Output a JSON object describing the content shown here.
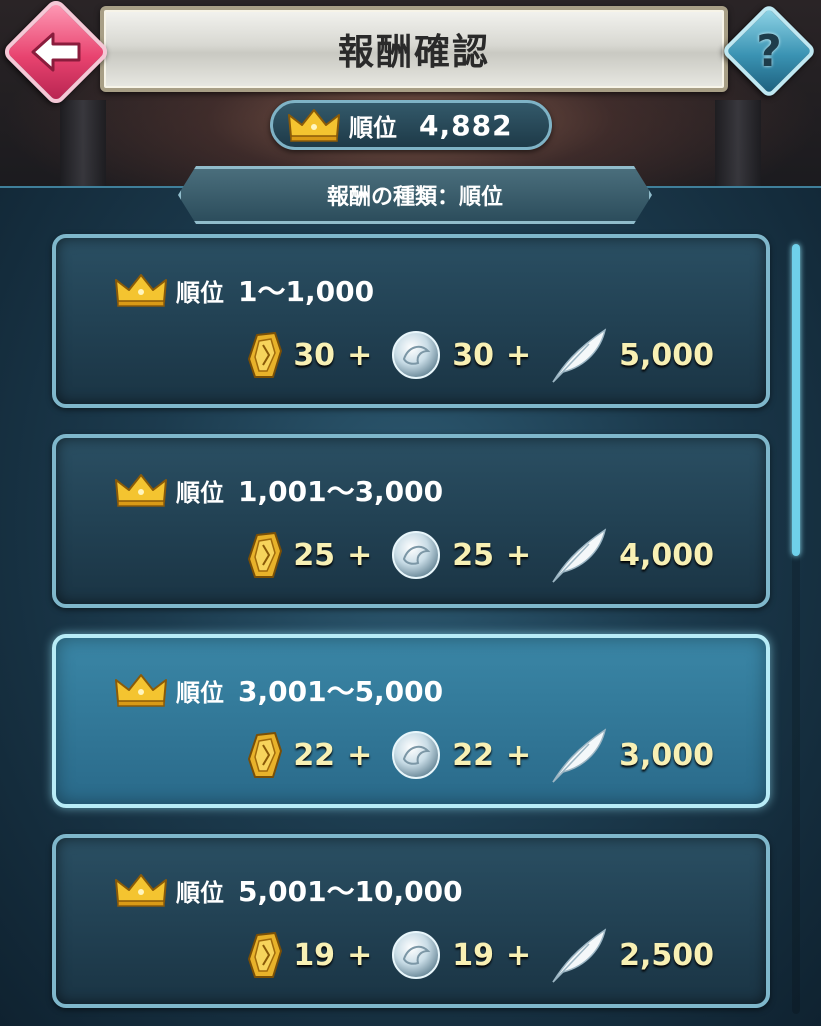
{
  "header": {
    "title": "報酬確認",
    "back_icon": "back-arrow-icon",
    "help_label": "?"
  },
  "current_rank": {
    "label": "順位",
    "value": "4,882",
    "icon": "crown-icon"
  },
  "reward_type": {
    "label": "報酬の種類：順位"
  },
  "rewards": [
    {
      "rank_label": "順位",
      "range": "1～1,000",
      "sacred_coin": "30",
      "orb": "30",
      "feather": "5,000",
      "highlighted": false
    },
    {
      "rank_label": "順位",
      "range": "1,001～3,000",
      "sacred_coin": "25",
      "orb": "25",
      "feather": "4,000",
      "highlighted": false
    },
    {
      "rank_label": "順位",
      "range": "3,001～5,000",
      "sacred_coin": "22",
      "orb": "22",
      "feather": "3,000",
      "highlighted": true
    },
    {
      "rank_label": "順位",
      "range": "5,001～10,000",
      "sacred_coin": "19",
      "orb": "19",
      "feather": "2,500",
      "highlighted": false
    }
  ],
  "separator": "+",
  "colors": {
    "accent_gold": "#f8f0b4",
    "panel_border": "#7fb7cb",
    "back_button": "#e8436f",
    "help_button": "#3a93b3"
  }
}
